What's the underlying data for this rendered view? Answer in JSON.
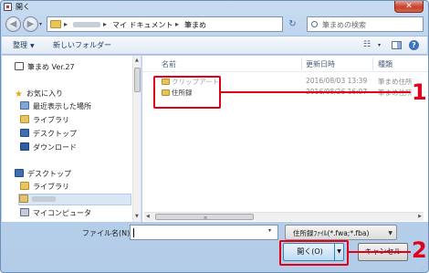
{
  "window": {
    "title": "開く",
    "close_glyph": "✕"
  },
  "nav": {
    "back_glyph": "◀",
    "forward_glyph": "▶",
    "breadcrumb": [
      "マイ ドキュメント",
      "筆まめ"
    ],
    "separator": "▶",
    "search_placeholder": "筆まめの検索"
  },
  "toolbar": {
    "organize_label": "整理",
    "new_folder_label": "新しいフォルダー",
    "view_glyph": "☷"
  },
  "sidebar": {
    "app_item": "筆まめ Ver.27",
    "favorites": {
      "header": "お気に入り",
      "items": [
        "最近表示した場所",
        "ライブラリ",
        "デスクトップ",
        "ダウンロード"
      ]
    },
    "desktop": {
      "header": "デスクトップ",
      "items": [
        "ライブラリ",
        "マイコンピュータ"
      ]
    }
  },
  "columns": {
    "name": "名前",
    "modified": "更新日時",
    "type": "種類"
  },
  "files": [
    {
      "name": "クリップアート",
      "modified": "2016/08/03 13:39",
      "type": "筆まめ住所"
    },
    {
      "name": "住所録",
      "modified": "2016/08/26 16:07",
      "type": "筆まめ住所"
    }
  ],
  "bottom": {
    "filename_label": "ファイル名(N):",
    "filename_value": "",
    "filter_value": "住所録ﾌｧｲﾙ(*.fwa;*.fba)",
    "open_label": "開く(O)",
    "cancel_label": "キャンセル"
  },
  "callouts": [
    "1",
    "2"
  ],
  "accent_color": "#e0001a"
}
